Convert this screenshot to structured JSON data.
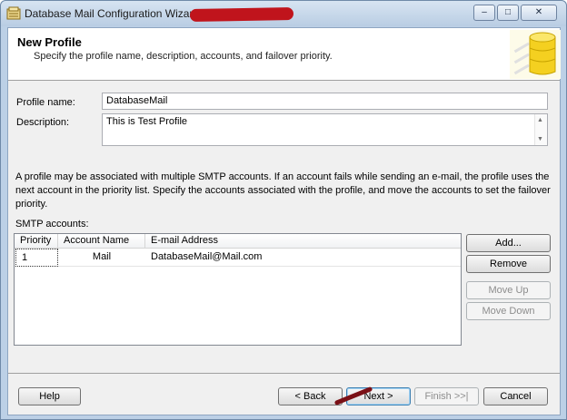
{
  "window": {
    "title": "Database Mail Configuration Wizard",
    "controls": {
      "minimize": "–",
      "maximize": "□",
      "close": "✕"
    }
  },
  "header": {
    "title": "New Profile",
    "subtitle": "Specify the profile name, description, accounts, and failover priority.",
    "icon": "database-icon"
  },
  "form": {
    "profile_name_label": "Profile name:",
    "profile_name_value": "DatabaseMail",
    "description_label": "Description:",
    "description_value": "This is Test Profile"
  },
  "info_text": "A profile may be associated with multiple SMTP accounts. If an account fails while sending an e-mail, the profile uses the next account in the priority list. Specify the accounts associated with the profile, and move the accounts to set the failover priority.",
  "smtp": {
    "label": "SMTP accounts:",
    "columns": [
      "Priority",
      "Account Name",
      "E-mail Address"
    ],
    "rows": [
      {
        "priority": "1",
        "account_name": "Mail",
        "email": "DatabaseMail@Mail.com"
      }
    ]
  },
  "side_buttons": {
    "add": "Add...",
    "remove": "Remove",
    "move_up": "Move Up",
    "move_down": "Move Down"
  },
  "footer": {
    "help": "Help",
    "back": "< Back",
    "next": "Next >",
    "finish": "Finish >>|",
    "cancel": "Cancel"
  },
  "colors": {
    "redaction": "#c0141c",
    "annotation": "#7a1016",
    "title_bar": "#bcd0e6"
  }
}
